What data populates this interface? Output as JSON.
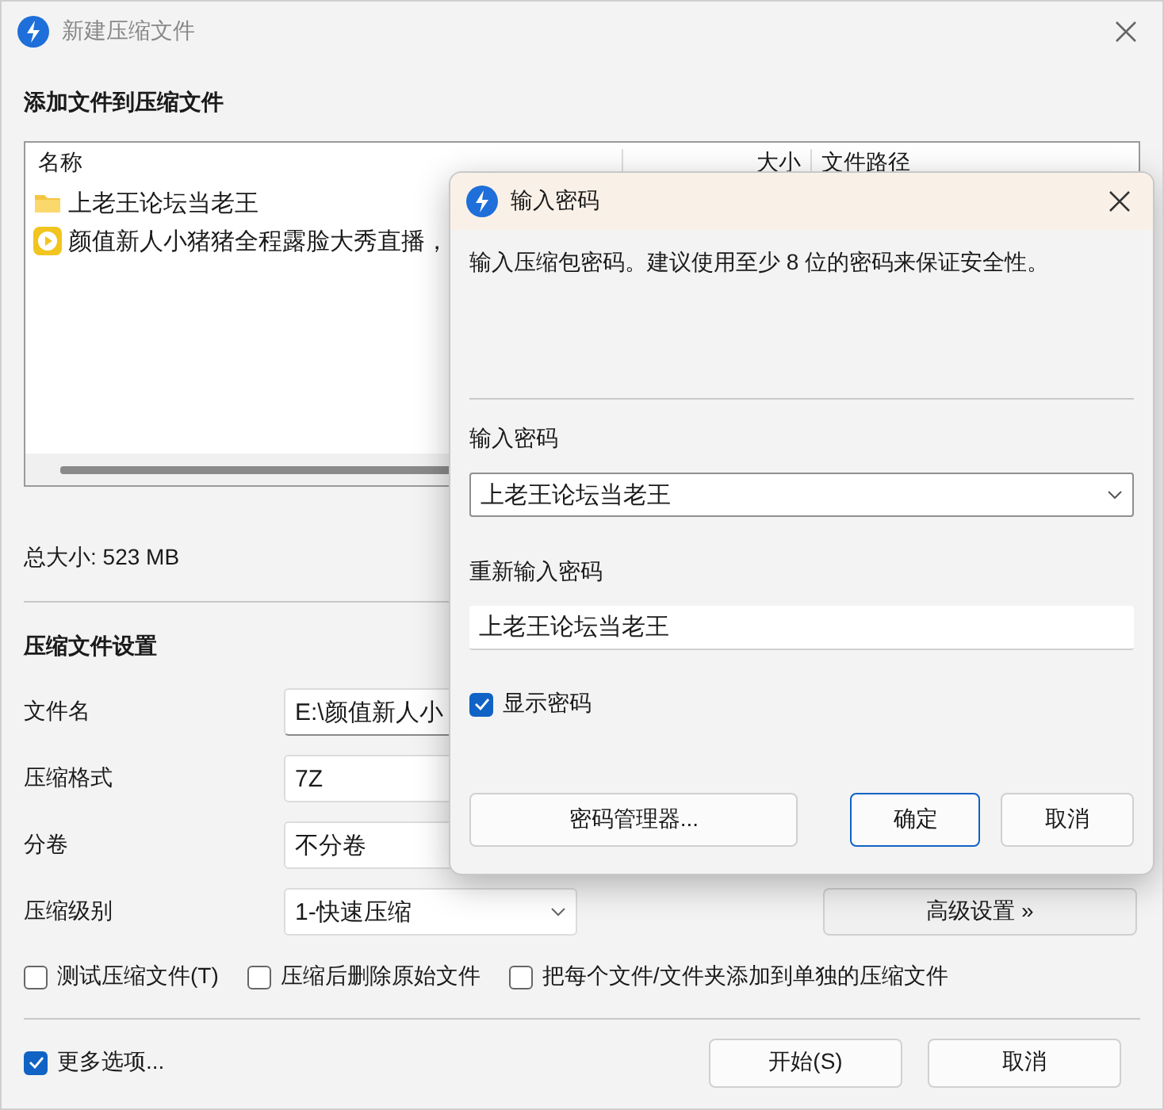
{
  "main_window": {
    "title": "新建压缩文件",
    "section_title": "添加文件到压缩文件",
    "file_list": {
      "columns": [
        "名称",
        "大小",
        "文件路径"
      ],
      "rows": [
        {
          "name": "上老王论坛当老王",
          "kind": "folder"
        },
        {
          "name": "颜值新人小猪猪全程露脸大秀直播，",
          "kind": "video"
        }
      ]
    },
    "total_size": "总大小: 523 MB",
    "settings": {
      "title": "压缩文件设置",
      "fields": [
        {
          "label": "文件名",
          "value": "E:\\颜值新人小",
          "kind": "text"
        },
        {
          "label": "压缩格式",
          "value": "7Z",
          "kind": "dropdown"
        },
        {
          "label": "分卷",
          "value": "不分卷",
          "kind": "dropdown"
        },
        {
          "label": "压缩级别",
          "value": "1-快速压缩",
          "kind": "dropdown"
        }
      ],
      "advanced_button": "高级设置 »",
      "options": [
        {
          "label": "测试压缩文件(T)",
          "checked": false
        },
        {
          "label": "压缩后删除原始文件",
          "checked": false
        },
        {
          "label": "把每个文件/文件夹添加到单独的压缩文件",
          "checked": false
        }
      ]
    },
    "more_options": {
      "label": "更多选项...",
      "checked": true
    },
    "buttons": [
      {
        "label": "开始(S)"
      },
      {
        "label": "取消"
      }
    ]
  },
  "password_dialog": {
    "title": "输入密码",
    "description": "输入压缩包密码。建议使用至少 8 位的密码来保证安全性。",
    "password_label": "输入密码",
    "password_value": "上老王论坛当老王",
    "confirm_label": "重新输入密码",
    "confirm_value": "上老王论坛当老王",
    "show_password": {
      "label": "显示密码",
      "checked": true
    },
    "buttons": [
      {
        "label": "密码管理器...",
        "focused": false
      },
      {
        "label": "确定",
        "focused": true
      },
      {
        "label": "取消",
        "focused": false
      }
    ]
  }
}
